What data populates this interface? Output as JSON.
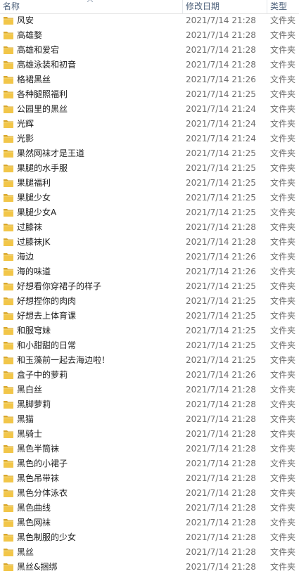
{
  "header": {
    "name_label": "名称",
    "date_label": "修改日期",
    "type_label": "类型"
  },
  "files": [
    {
      "name": "风安",
      "date": "2021/7/14 21:28",
      "type": "文件夹",
      "icon": "folder-icon"
    },
    {
      "name": "高雄婺",
      "date": "2021/7/14 21:28",
      "type": "文件夹",
      "icon": "folder-icon"
    },
    {
      "name": "高雄和爱宕",
      "date": "2021/7/14 21:28",
      "type": "文件夹",
      "icon": "folder-icon"
    },
    {
      "name": "高雄泳装和初音",
      "date": "2021/7/14 21:28",
      "type": "文件夹",
      "icon": "folder-icon"
    },
    {
      "name": "格裙黑丝",
      "date": "2021/7/14 21:26",
      "type": "文件夹",
      "icon": "folder-icon"
    },
    {
      "name": "各种腿照福利",
      "date": "2021/7/14 21:25",
      "type": "文件夹",
      "icon": "folder-icon"
    },
    {
      "name": "公园里的黑丝",
      "date": "2021/7/14 21:24",
      "type": "文件夹",
      "icon": "folder-icon"
    },
    {
      "name": "光辉",
      "date": "2021/7/14 21:24",
      "type": "文件夹",
      "icon": "folder-icon"
    },
    {
      "name": "光影",
      "date": "2021/7/14 21:24",
      "type": "文件夹",
      "icon": "folder-icon"
    },
    {
      "name": "果然网袜才是王道",
      "date": "2021/7/14 21:25",
      "type": "文件夹",
      "icon": "folder-icon"
    },
    {
      "name": "果腿的水手服",
      "date": "2021/7/14 21:25",
      "type": "文件夹",
      "icon": "folder-icon"
    },
    {
      "name": "果腿福利",
      "date": "2021/7/14 21:25",
      "type": "文件夹",
      "icon": "folder-icon"
    },
    {
      "name": "果腿少女",
      "date": "2021/7/14 21:25",
      "type": "文件夹",
      "icon": "folder-icon"
    },
    {
      "name": "果腿少女A",
      "date": "2021/7/14 21:25",
      "type": "文件夹",
      "icon": "folder-icon"
    },
    {
      "name": "过膝袜",
      "date": "2021/7/14 21:28",
      "type": "文件夹",
      "icon": "folder-icon"
    },
    {
      "name": "过膝袜JK",
      "date": "2021/7/14 21:28",
      "type": "文件夹",
      "icon": "folder-icon"
    },
    {
      "name": "海边",
      "date": "2021/7/14 21:26",
      "type": "文件夹",
      "icon": "folder-icon"
    },
    {
      "name": "海的味道",
      "date": "2021/7/14 21:26",
      "type": "文件夹",
      "icon": "folder-icon"
    },
    {
      "name": "好想看你穿裙子的样子",
      "date": "2021/7/14 21:25",
      "type": "文件夹",
      "icon": "folder-icon"
    },
    {
      "name": "好想捏你的肉肉",
      "date": "2021/7/14 21:25",
      "type": "文件夹",
      "icon": "folder-icon"
    },
    {
      "name": "好想去上体育课",
      "date": "2021/7/14 21:25",
      "type": "文件夹",
      "icon": "folder-icon"
    },
    {
      "name": "和服穹妹",
      "date": "2021/7/14 21:25",
      "type": "文件夹",
      "icon": "folder-icon"
    },
    {
      "name": "和小甜甜的日常",
      "date": "2021/7/14 21:25",
      "type": "文件夹",
      "icon": "folder-icon"
    },
    {
      "name": "和玉藻前一起去海边啦！",
      "date": "2021/7/14 21:25",
      "type": "文件夹",
      "icon": "folder-icon"
    },
    {
      "name": "盒子中的萝莉",
      "date": "2021/7/14 21:26",
      "type": "文件夹",
      "icon": "folder-icon"
    },
    {
      "name": "黑白丝",
      "date": "2021/7/14 21:28",
      "type": "文件夹",
      "icon": "folder-icon"
    },
    {
      "name": "黑脚萝莉",
      "date": "2021/7/14 21:28",
      "type": "文件夹",
      "icon": "folder-icon"
    },
    {
      "name": "黑猫",
      "date": "2021/7/14 21:28",
      "type": "文件夹",
      "icon": "folder-icon"
    },
    {
      "name": "黑骑士",
      "date": "2021/7/14 21:28",
      "type": "文件夹",
      "icon": "folder-icon"
    },
    {
      "name": "黑色半筒袜",
      "date": "2021/7/14 21:28",
      "type": "文件夹",
      "icon": "folder-icon"
    },
    {
      "name": "黑色的小裙子",
      "date": "2021/7/14 21:28",
      "type": "文件夹",
      "icon": "folder-icon"
    },
    {
      "name": "黑色吊带袜",
      "date": "2021/7/14 21:28",
      "type": "文件夹",
      "icon": "folder-icon"
    },
    {
      "name": "黑色分体泳衣",
      "date": "2021/7/14 21:28",
      "type": "文件夹",
      "icon": "folder-icon"
    },
    {
      "name": "黑色曲线",
      "date": "2021/7/14 21:28",
      "type": "文件夹",
      "icon": "folder-icon"
    },
    {
      "name": "黑色网袜",
      "date": "2021/7/14 21:28",
      "type": "文件夹",
      "icon": "folder-icon"
    },
    {
      "name": "黑色制服的少女",
      "date": "2021/7/14 21:28",
      "type": "文件夹",
      "icon": "folder-icon"
    },
    {
      "name": "黑丝",
      "date": "2021/7/14 21:28",
      "type": "文件夹",
      "icon": "folder-icon"
    },
    {
      "name": "黑丝&捆绑",
      "date": "2021/7/14 21:28",
      "type": "文件夹",
      "icon": "folder-icon"
    }
  ],
  "colors": {
    "folder_front": "#f2c649",
    "folder_back": "#d9a72b",
    "header_text": "#4c607a",
    "meta_text": "#6d6d6d"
  }
}
